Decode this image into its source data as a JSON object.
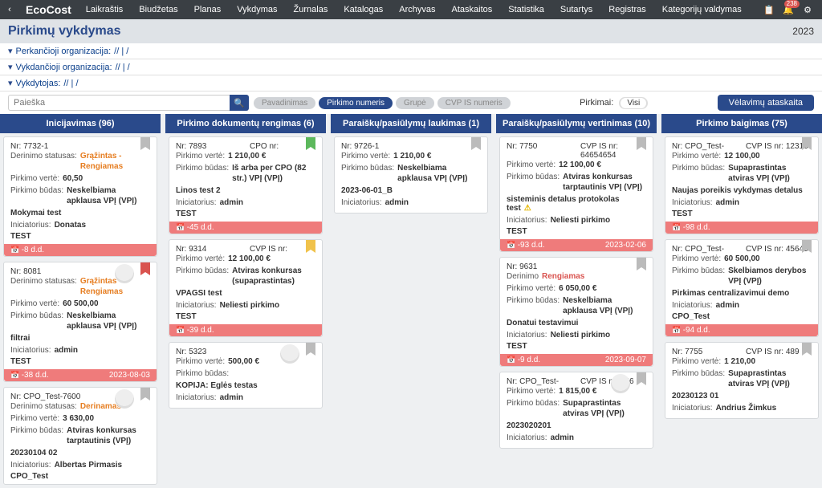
{
  "topbar": {
    "logo": "EcoCost",
    "nav": [
      "Laikraštis",
      "Biudžetas",
      "Planas",
      "Vykdymas",
      "Žurnalas",
      "Katalogas",
      "Archyvas",
      "Ataskaitos",
      "Statistika",
      "Sutartys",
      "Registras",
      "Kategorijų valdymas"
    ],
    "notif_count": "238"
  },
  "page_title": "Pirkimų vykdymas",
  "year": "2023",
  "filters": {
    "f1_label": "Perkančioji organizacija:",
    "f1_val": "// | /",
    "f2_label": "Vykdančioji organizacija:",
    "f2_val": "// | /",
    "f3_label": "Vykdytojas:",
    "f3_val": "// | /"
  },
  "search_placeholder": "Paieška",
  "chips": {
    "c1": "Pavadinimas",
    "c2": "Pirkimo numeris",
    "c3": "Grupė",
    "c4": "CVP IS numeris"
  },
  "mid_label": "Pirkimai:",
  "toggle_label": "Visi",
  "report_btn": "Vėlavimų ataskaita",
  "labels": {
    "nr": "Nr:",
    "cpo": "CPO nr:",
    "cvp": "CVP IS nr:",
    "derinimo": "Derinimo statusas:",
    "derinimo_short": "Derinimo",
    "verte": "Pirkimo vertė:",
    "budas": "Pirkimo būdas:",
    "inic": "Iniciatorius:"
  },
  "columns": [
    {
      "title": "Inicijavimas (96)",
      "cards": [
        {
          "nr": "7732-1",
          "flag": "grey",
          "kv": [
            [
              "derinimo",
              "Grąžintas - Rengiamas",
              "orange"
            ],
            [
              "verte",
              "60,50",
              ""
            ],
            [
              "budas",
              "Neskelbiama apklausa VPĮ (VPĮ)",
              ""
            ]
          ],
          "title": "Mokymai test",
          "inic": "Donatas",
          "org": "TEST",
          "footer_left": "-8 d.d.",
          "footer_right": ""
        },
        {
          "nr": "8081",
          "flag": "red",
          "avatar": true,
          "kv": [
            [
              "derinimo",
              "Grąžintas - Rengiamas",
              "orange"
            ],
            [
              "verte",
              "60 500,00",
              ""
            ],
            [
              "budas",
              "Neskelbiama apklausa VPĮ (VPĮ)",
              ""
            ]
          ],
          "title": "filtrai",
          "inic": "admin",
          "org": "TEST",
          "footer_left": "-38 d.d.",
          "footer_right": "2023-08-03"
        },
        {
          "nr": "CPO_Test-7600",
          "flag": "grey",
          "avatar": true,
          "kv": [
            [
              "derinimo",
              "Derinamas",
              "orange"
            ],
            [
              "verte",
              "3 630,00",
              ""
            ],
            [
              "budas",
              "Atviras konkursas tarptautinis (VPĮ)",
              ""
            ]
          ],
          "title": "20230104 02",
          "inic": "Albertas Pirmasis",
          "org": "CPO_Test"
        }
      ]
    },
    {
      "title": "Pirkimo dokumentų rengimas (6)",
      "cards": [
        {
          "nr": "7893",
          "cpo": "",
          "flag": "green",
          "kv": [
            [
              "verte",
              "1 210,00 €",
              ""
            ],
            [
              "budas",
              "Iš arba per CPO (82 str.) VPĮ (VPĮ)",
              ""
            ]
          ],
          "title": "Linos test 2",
          "inic": "admin",
          "org": "TEST",
          "footer_left": "-45 d.d.",
          "footer_right": ""
        },
        {
          "nr": "9314",
          "cvp": "",
          "flag": "yellow",
          "kv": [
            [
              "verte",
              "12 100,00 €",
              ""
            ],
            [
              "budas",
              "Atviras konkursas (supaprastintas)",
              ""
            ]
          ],
          "title": "VPAGSI test",
          "inic": "Neliesti pirkimo",
          "org": "TEST",
          "footer_left": "-39 d.d.",
          "footer_right": ""
        },
        {
          "nr": "5323",
          "flag": "grey",
          "avatar": true,
          "kv": [
            [
              "verte",
              "500,00 €",
              ""
            ],
            [
              "budas",
              "",
              ""
            ]
          ],
          "title": "KOPIJA: Eglės testas",
          "inic": "admin",
          "org": ""
        }
      ]
    },
    {
      "title": "Paraiškų/pasiūlymų laukimas (1)",
      "cards": [
        {
          "nr": "9726-1",
          "flag": "grey",
          "kv": [
            [
              "verte",
              "1 210,00 €",
              ""
            ],
            [
              "budas",
              "Neskelbiama apklausa VPĮ (VPĮ)",
              ""
            ]
          ],
          "title": "2023-06-01_B",
          "inic": "admin",
          "org": ""
        }
      ]
    },
    {
      "title": "Paraiškų/pasiūlymų vertinimas (10)",
      "cards": [
        {
          "nr": "7750",
          "cvp": "64654654",
          "flag": "grey",
          "kv": [
            [
              "verte",
              "12 100,00 €",
              ""
            ],
            [
              "budas",
              "Atviras konkursas tarptautinis VPĮ (VPĮ)",
              ""
            ]
          ],
          "title": "sisteminis detalus protokolas test",
          "warn": true,
          "inic": "Neliesti pirkimo",
          "org": "TEST",
          "footer_left": "-93 d.d.",
          "footer_right": "2023-02-06"
        },
        {
          "nr": "9631",
          "flag": "grey",
          "kv": [
            [
              "derinimo_short",
              "Rengiamas",
              "red"
            ],
            [
              "verte",
              "6 050,00 €",
              ""
            ],
            [
              "budas",
              "Neskelbiama apklausa VPĮ (VPĮ)",
              ""
            ]
          ],
          "title": "Donatui testavimui",
          "inic": "Neliesti pirkimo",
          "org": "TEST",
          "footer_left": "-9 d.d.",
          "footer_right": "2023-09-07"
        },
        {
          "nr": "CPO_Test-",
          "cvp": "456",
          "flag": "grey",
          "avatar": true,
          "kv": [
            [
              "verte",
              "1 815,00 €",
              ""
            ],
            [
              "budas",
              "Supaprastintas atviras VPĮ (VPĮ)",
              ""
            ]
          ],
          "title": "2023020201",
          "inic": "admin",
          "org": ""
        }
      ]
    },
    {
      "title": "Pirkimo baigimas (75)",
      "cards": [
        {
          "nr": "CPO_Test-",
          "cvp": "12313",
          "flag": "grey",
          "kv": [
            [
              "verte",
              "12 100,00",
              ""
            ],
            [
              "budas",
              "Supaprastintas atviras VPĮ (VPĮ)",
              ""
            ]
          ],
          "title": "Naujas poreikis vykdymas detalus",
          "inic": "admin",
          "org": "TEST",
          "footer_left": "-98 d.d.",
          "footer_right": ""
        },
        {
          "nr": "CPO_Test-",
          "cvp": "45645",
          "flag": "grey",
          "kv": [
            [
              "verte",
              "60 500,00",
              ""
            ],
            [
              "budas",
              "Skelbiamos derybos VPĮ (VPĮ)",
              ""
            ]
          ],
          "title": "Pirkimas centralizavimui demo",
          "inic": "admin",
          "org": "CPO_Test",
          "footer_left": "-94 d.d.",
          "footer_right": ""
        },
        {
          "nr": "7755",
          "cvp": "489",
          "flag": "grey",
          "kv": [
            [
              "verte",
              "1 210,00",
              ""
            ],
            [
              "budas",
              "Supaprastintas atviras VPĮ (VPĮ)",
              ""
            ]
          ],
          "title": "20230123 01",
          "inic": "Andrius Žimkus",
          "org": ""
        }
      ]
    }
  ]
}
